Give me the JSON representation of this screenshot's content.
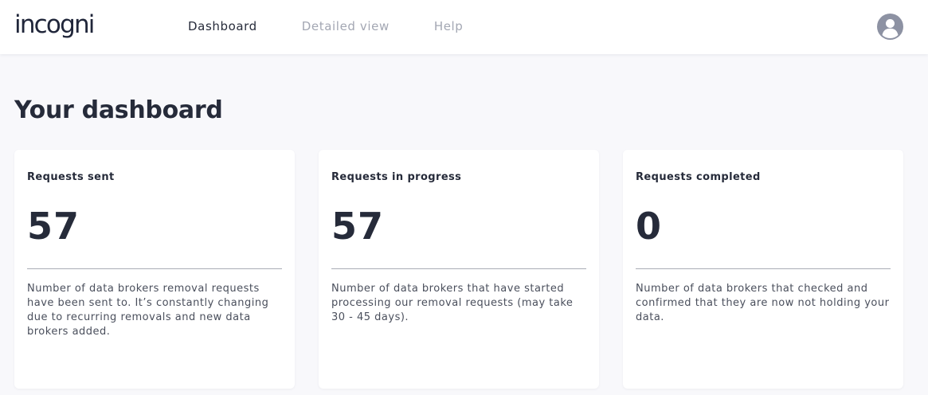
{
  "header": {
    "logo_text": "incogni",
    "nav": [
      {
        "label": "Dashboard"
      },
      {
        "label": "Detailed view"
      },
      {
        "label": "Help"
      }
    ],
    "avatar_icon": "user-avatar-icon"
  },
  "main": {
    "title": "Your dashboard",
    "cards": [
      {
        "title": "Requests sent",
        "value": "57",
        "description": "Number of data brokers removal requests have been sent to. It’s constantly changing due to recurring removals and new data brokers added."
      },
      {
        "title": "Requests in progress",
        "value": "57",
        "description": "Number of data brokers that have started processing our removal requests (may take 30 - 45 days)."
      },
      {
        "title": "Requests completed",
        "value": "0",
        "description": "Number of data brokers that checked and confirmed that they are now not holding your data."
      }
    ]
  },
  "colors": {
    "background": "#f8f8fb",
    "text_primary": "#262b3a",
    "nav_inactive": "#a3a7b3",
    "avatar": "#8d92a3"
  }
}
